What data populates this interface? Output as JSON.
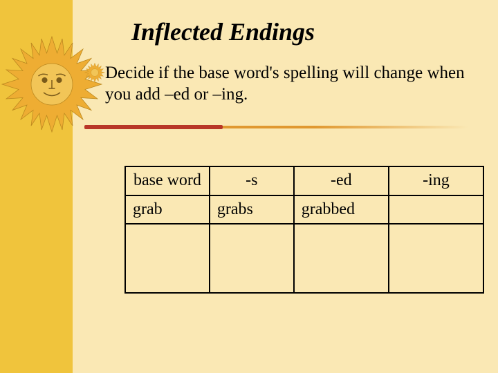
{
  "title": "Inflected Endings",
  "subtitle": "Decide if the base word's spelling will change when you add –ed or –ing.",
  "table": {
    "headers": {
      "base": "base word",
      "s": "-s",
      "ed": "-ed",
      "ing": "-ing"
    },
    "rows": [
      {
        "base": "grab",
        "s": "grabs",
        "ed": "grabbed",
        "ing": ""
      }
    ]
  },
  "icons": {
    "sun_fill": "#eead33",
    "sun_face": "#cfa430"
  }
}
